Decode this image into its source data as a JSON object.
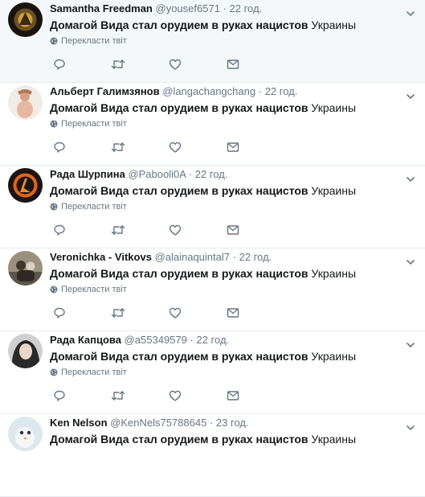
{
  "translate_label": "Перекласти твіт",
  "tweets": [
    {
      "fullname": "Samantha Freedman",
      "username": "@yousef6571",
      "dot": "·",
      "time": "22 год.",
      "text_bold": "Домагой Вида стал орудием в руках нацистов",
      "text_plain": " Украины",
      "avatar_icon": "dark-logo-avatar"
    },
    {
      "fullname": "Альберт Галимзянов",
      "username": "@langachangchang",
      "dot": "·",
      "time": "22 год.",
      "text_bold": "Домагой Вида стал орудием в руках нацистов",
      "text_plain": " Украины",
      "avatar_icon": "figure-avatar"
    },
    {
      "fullname": "Рада Шурпина",
      "username": "@Paboolі0A",
      "dot": "·",
      "time": "22 год.",
      "text_bold": "Домагой Вида стал орудием в руках нацистов",
      "text_plain": " Украины",
      "avatar_icon": "half-life-logo-avatar"
    },
    {
      "fullname": "Veronichka - Vitkovs",
      "username": "@alainaquintal7",
      "dot": "·",
      "time": "22 год.",
      "text_bold": "Домагой Вида стал орудием в руках нацистов",
      "text_plain": " Украины",
      "avatar_icon": "vintage-photo-avatar"
    },
    {
      "fullname": "Рада Капцова",
      "username": "@a55349579",
      "dot": "·",
      "time": "22 год.",
      "text_bold": "Домагой Вида стал орудием в руках нацистов",
      "text_plain": " Украины",
      "avatar_icon": "portrait-avatar"
    },
    {
      "fullname": "Ken Nelson",
      "username": "@KenNels75788645",
      "dot": "·",
      "time": "23 год.",
      "text_bold": "Домагой Вида стал орудием в руках нацистов",
      "text_plain": " Украины",
      "avatar_icon": "bird-avatar"
    }
  ],
  "icons": {
    "reply": "reply-icon",
    "retweet": "retweet-icon",
    "like": "heart-icon",
    "dm": "envelope-icon",
    "more": "chevron-down-icon",
    "translate": "globe-icon"
  },
  "colors": {
    "text": "#14171a",
    "muted": "#657786",
    "highlight_bg": "#f5f8fa",
    "border": "#e6ecf0"
  }
}
